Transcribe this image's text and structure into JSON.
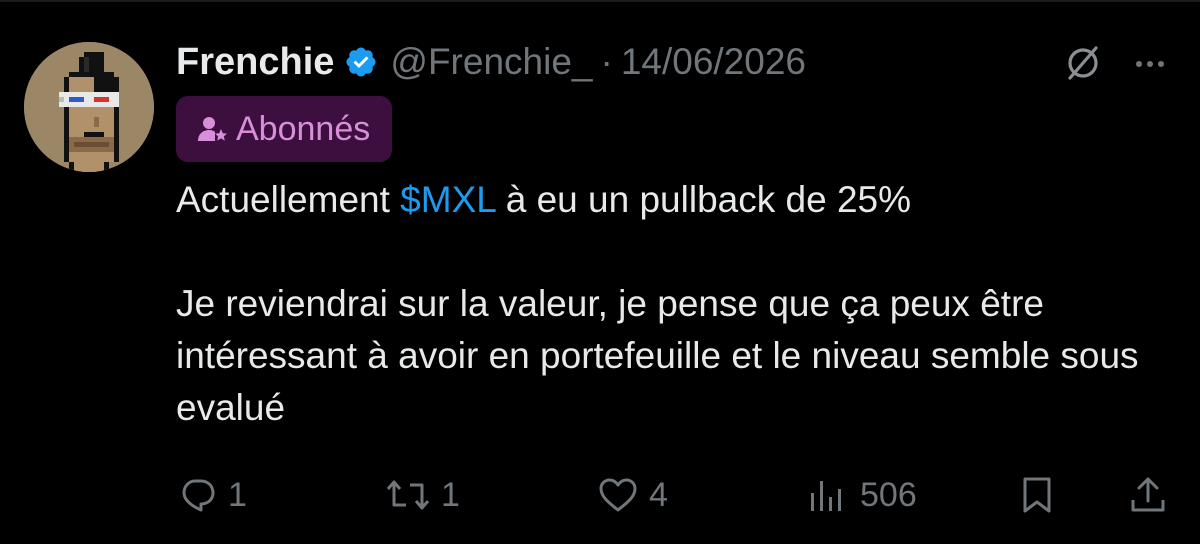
{
  "author": {
    "name": "Frenchie",
    "handle": "@Frenchie_",
    "separator": "·",
    "date": "14/06/2026",
    "verified": true
  },
  "badge": {
    "label": "Abonnés",
    "icon": "subscriber-star-icon"
  },
  "tweet": {
    "line1_prefix": "Actuellement ",
    "cashtag": "$MXL",
    "line1_suffix": " à eu un pullback de 25%",
    "paragraph2": "Je reviendrai sur la valeur, je pense que ça peux être intéressant à avoir en portefeuille et le niveau semble sous evalué"
  },
  "actions": {
    "replies": "1",
    "reposts": "1",
    "likes": "4",
    "views": "506"
  },
  "colors": {
    "background": "#000000",
    "text": "#e7e9ea",
    "muted": "#71767b",
    "accent": "#1d9bf0",
    "badge_bg": "#3d0f3f",
    "badge_text": "#d78fd9"
  },
  "icons": {
    "header": [
      "verified-badge-icon",
      "grok-icon",
      "more-icon"
    ],
    "actions": [
      "reply-icon",
      "repost-icon",
      "like-icon",
      "views-icon",
      "bookmark-icon",
      "share-icon"
    ]
  }
}
